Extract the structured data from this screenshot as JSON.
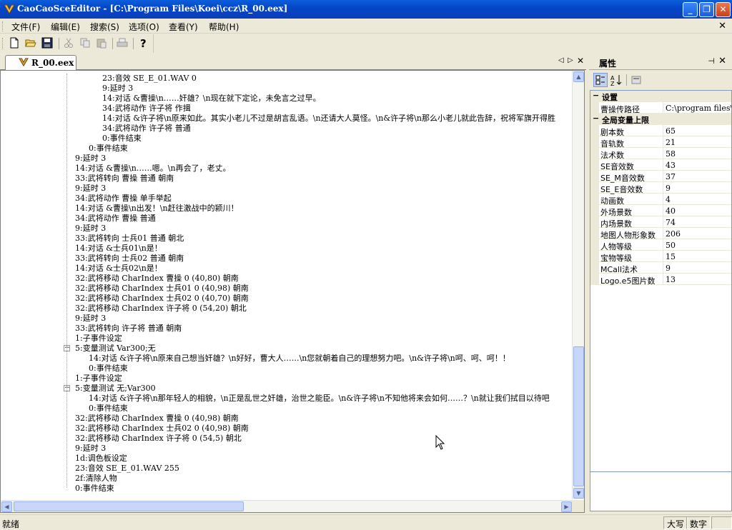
{
  "window": {
    "title": "CaoCaoSceEditor - [C:\\Program Files\\Koei\\ccz\\R_00.eex]"
  },
  "menu": [
    {
      "label": "文件(F)"
    },
    {
      "label": "编辑(E)"
    },
    {
      "label": "搜索(S)"
    },
    {
      "label": "选项(O)"
    },
    {
      "label": "查看(Y)"
    },
    {
      "label": "帮助(H)"
    }
  ],
  "toolbar": {
    "icons": [
      "new-file-icon",
      "open-folder-icon",
      "save-icon",
      "cut-icon",
      "copy-icon",
      "paste-icon",
      "print-icon",
      "help-icon"
    ]
  },
  "document_tab": {
    "label": "R_00.eex"
  },
  "script_lines": [
    {
      "text": "23:音效 SE_E_01.WAV 0",
      "indent": 2
    },
    {
      "text": "9:延时 3",
      "indent": 2
    },
    {
      "text": "14:对话 &曹操\\n……奸雄？\\n现在就下定论，未免言之过早。",
      "indent": 2
    },
    {
      "text": "34:武将动作 许子将 作揖",
      "indent": 2
    },
    {
      "text": "14:对话 &许子将\\n原来如此。其实小老儿不过是胡言乱语。\\n还请大人莫怪。\\n&许子将\\n那么小老儿就此告辞，祝将军旗开得胜",
      "indent": 2
    },
    {
      "text": "34:武将动作 许子将 普通",
      "indent": 2
    },
    {
      "text": "0:事件结束",
      "indent": 2
    },
    {
      "text": "0:事件结束",
      "indent": 1
    },
    {
      "text": "9:延时 3",
      "indent": 0
    },
    {
      "text": "14:对话 &曹操\\n……嗯。\\n再会了，老丈。",
      "indent": 0
    },
    {
      "text": "33:武将转向 曹操 普通 朝南",
      "indent": 0
    },
    {
      "text": "9:延时 3",
      "indent": 0
    },
    {
      "text": "34:武将动作 曹操 单手举起",
      "indent": 0
    },
    {
      "text": "14:对话 &曹操\\n出发！\\n赶往激战中的颍川！",
      "indent": 0
    },
    {
      "text": "34:武将动作 曹操 普通",
      "indent": 0
    },
    {
      "text": "9:延时 3",
      "indent": 0
    },
    {
      "text": "33:武将转向 士兵01 普通 朝北",
      "indent": 0
    },
    {
      "text": "14:对话 &士兵01\\n是！",
      "indent": 0
    },
    {
      "text": "33:武将转向 士兵02 普通 朝南",
      "indent": 0
    },
    {
      "text": "14:对话 &士兵02\\n是！",
      "indent": 0
    },
    {
      "text": "32:武将移动 CharIndex 曹操 0 (40,80) 朝南",
      "indent": 0
    },
    {
      "text": "32:武将移动 CharIndex 士兵01 0 (40,98) 朝南",
      "indent": 0
    },
    {
      "text": "32:武将移动 CharIndex 士兵02 0 (40,70) 朝南",
      "indent": 0
    },
    {
      "text": "32:武将移动 CharIndex 许子将 0 (54,20) 朝北",
      "indent": 0
    },
    {
      "text": "9:延时 3",
      "indent": 0
    },
    {
      "text": "33:武将转向 许子将 普通 朝南",
      "indent": 0
    },
    {
      "text": "1:子事件设定",
      "indent": 0
    },
    {
      "text": "5:变量测试 Var300;无",
      "indent": 0,
      "toggle": "−"
    },
    {
      "text": "14:对话 &许子将\\n原来自己想当奸雄？\\n好好，曹大人……\\n您就朝着自己的理想努力吧。\\n&许子将\\n呵、呵、呵！！",
      "indent": 1
    },
    {
      "text": "0:事件结束",
      "indent": 1
    },
    {
      "text": "1:子事件设定",
      "indent": 0
    },
    {
      "text": "5:变量测试 无;Var300",
      "indent": 0,
      "toggle": "−"
    },
    {
      "text": "14:对话 &许子将\\n那年轻人的相貌，\\n正是乱世之奸雄，治世之能臣。\\n&许子将\\n不知他将来会如何……？\\n就让我们拭目以待吧",
      "indent": 1
    },
    {
      "text": "0:事件结束",
      "indent": 1
    },
    {
      "text": "32:武将移动 CharIndex 曹操 0 (40,98) 朝南",
      "indent": 0
    },
    {
      "text": "32:武将移动 CharIndex 士兵02 0 (40,98) 朝南",
      "indent": 0
    },
    {
      "text": "32:武将移动 CharIndex 许子将 0 (54,5) 朝北",
      "indent": 0
    },
    {
      "text": "9:延时 3",
      "indent": 0
    },
    {
      "text": "1d:调色板设定",
      "indent": 0
    },
    {
      "text": "23:音效 SE_E_01.WAV 255",
      "indent": 0
    },
    {
      "text": "2f:清除人物",
      "indent": 0
    },
    {
      "text": "0:事件结束",
      "indent": 0
    }
  ],
  "properties": {
    "title": "属性",
    "sections": [
      {
        "name": "设置",
        "toggle": "−",
        "rows": [
          {
            "name": "曹操传路径",
            "value": "C:\\program files\\koei\\ccz"
          }
        ]
      },
      {
        "name": "全局变量上限",
        "toggle": "−",
        "rows": [
          {
            "name": "剧本数",
            "value": "65"
          },
          {
            "name": "音轨数",
            "value": "21"
          },
          {
            "name": "法术数",
            "value": "58"
          },
          {
            "name": "SE音效数",
            "value": "43"
          },
          {
            "name": "SE_M音效数",
            "value": "37"
          },
          {
            "name": "SE_E音效数",
            "value": "9"
          },
          {
            "name": "动画数",
            "value": "4"
          },
          {
            "name": "外场景数",
            "value": "40"
          },
          {
            "name": "内场景数",
            "value": "74"
          },
          {
            "name": "地图人物形象数",
            "value": "206"
          },
          {
            "name": "人物等级",
            "value": "50"
          },
          {
            "name": "宝物等级",
            "value": "15"
          },
          {
            "name": "MCall法术",
            "value": "9"
          },
          {
            "name": "Logo.e5图片数",
            "value": "13"
          }
        ]
      }
    ]
  },
  "status": {
    "text": "就绪",
    "caps": "大写",
    "num": "数字"
  }
}
